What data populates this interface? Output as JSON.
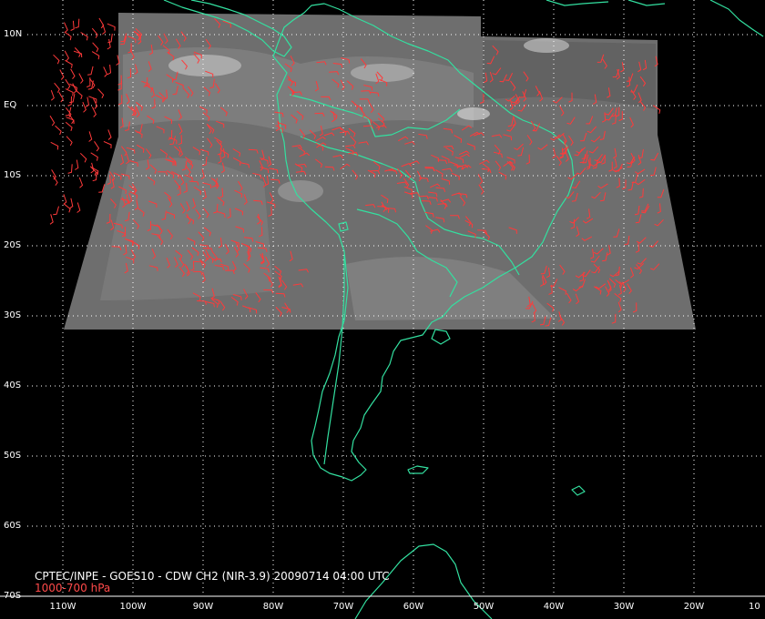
{
  "title": "CPTEC/INPE - GOES10 - CDW CH2 (NIR-3.9) 20090714 04:00 UTC",
  "layer": "1000-700 hPa",
  "colors": {
    "background": "#000000",
    "imagery": "#7a7a7a",
    "coastline": "#33e0a0",
    "wind_barbs": "#ff3a3a",
    "gridlines": "#ffffff",
    "layer_text": "#ff4a4a"
  },
  "map": {
    "lat_labels": [
      "10N",
      "EQ",
      "10S",
      "20S",
      "30S",
      "40S",
      "50S",
      "60S",
      "70S"
    ],
    "lon_labels": [
      "110W",
      "100W",
      "90W",
      "80W",
      "70W",
      "60W",
      "50W",
      "40W",
      "30W",
      "20W",
      "10"
    ],
    "gridlines": "dotted",
    "overlays": [
      "satellite-imagery",
      "coastlines-and-borders",
      "wind-barbs"
    ]
  }
}
